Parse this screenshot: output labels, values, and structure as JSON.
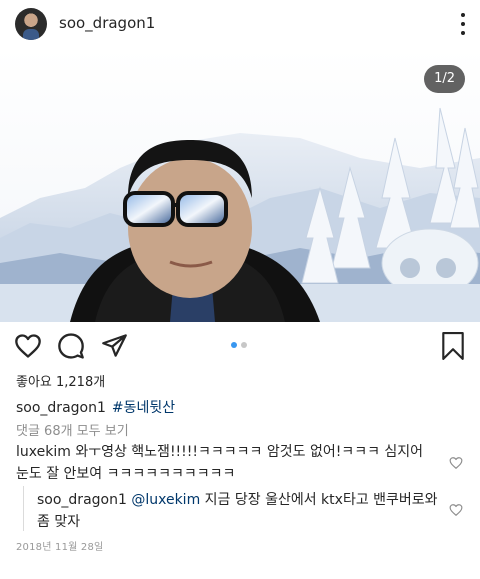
{
  "header": {
    "username": "soo_dragon1",
    "avatar_icon": "profile-avatar",
    "more_icon": "vertical-ellipsis-icon"
  },
  "media": {
    "counter": "1/2",
    "description_icon": "photo-selfie-snowy-mountains"
  },
  "actions": {
    "like_icon": "heart-outline-icon",
    "comment_icon": "comment-bubble-icon",
    "share_icon": "paper-plane-icon",
    "save_icon": "bookmark-outline-icon",
    "carousel_pages": 2,
    "carousel_current": 1
  },
  "post": {
    "likes_text": "좋아요 1,218개",
    "caption_user": "soo_dragon1",
    "caption_hashtag": "#동네뒷산",
    "view_all_comments": "댓글 68개 모두 보기"
  },
  "comments": [
    {
      "user": "luxekim",
      "text": "와ㅜ영상 핵노잼!!!!!ㅋㅋㅋㅋㅋ 암것도 없어!ㅋㅋㅋ 심지어 눈도 잘 안보여 ㅋㅋㅋㅋㅋㅋㅋㅋㅋㅋ"
    }
  ],
  "reply": {
    "user": "soo_dragon1",
    "mention": "@luxekim",
    "text": "지금 당장 울산에서 ktx타고 밴쿠버로와 좀 맞자"
  },
  "date": "2018년 11월 28일",
  "colors": {
    "accent_blue": "#3897f0",
    "link_blue": "#00376b",
    "secondary_text": "#8e8e8e"
  }
}
